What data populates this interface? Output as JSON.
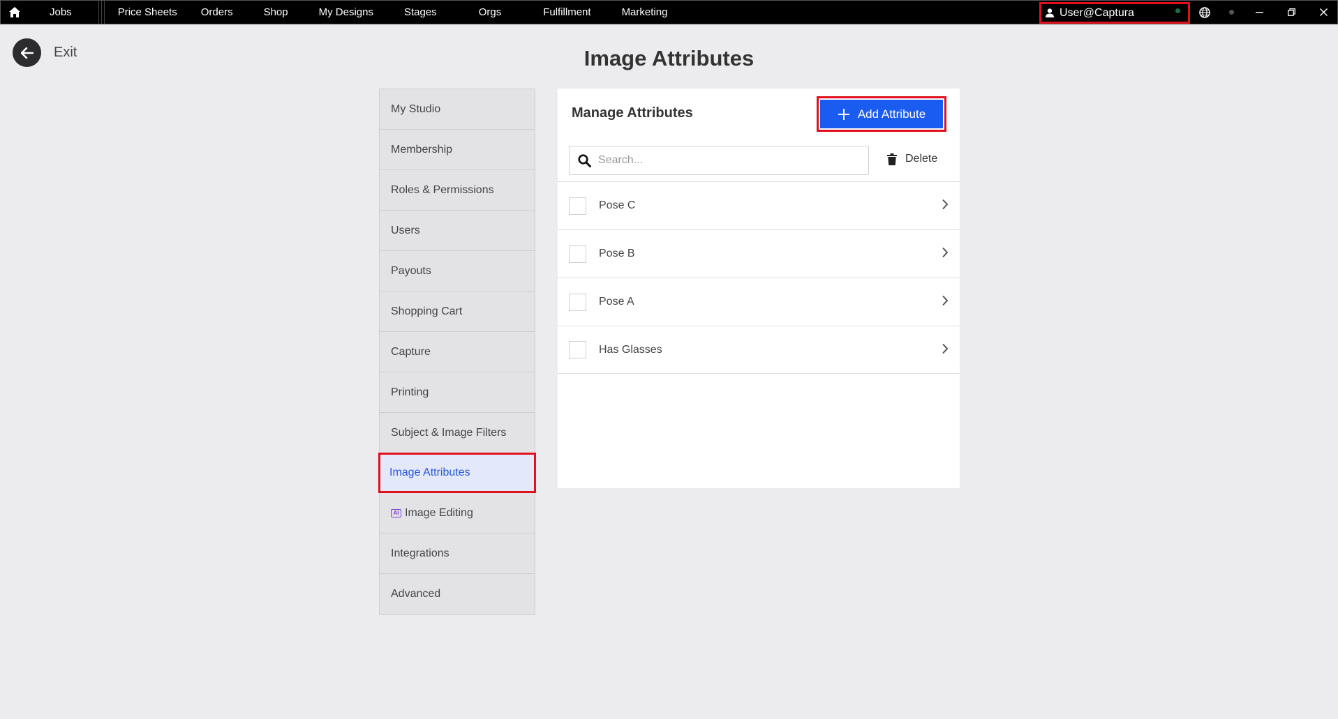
{
  "topbar": {
    "nav": [
      "Jobs",
      "Price Sheets",
      "Orders",
      "Shop",
      "My Designs",
      "Stages",
      "Orgs",
      "Fulfillment",
      "Marketing"
    ],
    "user": "User@Captura",
    "icons": [
      "home-icon",
      "user-icon",
      "globe-icon",
      "status-dot-icon",
      "minimize-icon",
      "restore-icon",
      "close-icon"
    ]
  },
  "exit": {
    "label": "Exit"
  },
  "page": {
    "title": "Image Attributes"
  },
  "sidebar": {
    "items": [
      {
        "label": "My Studio"
      },
      {
        "label": "Membership"
      },
      {
        "label": "Roles & Permissions"
      },
      {
        "label": "Users"
      },
      {
        "label": "Payouts"
      },
      {
        "label": "Shopping Cart"
      },
      {
        "label": "Capture"
      },
      {
        "label": "Printing"
      },
      {
        "label": "Subject & Image Filters"
      },
      {
        "label": "Image Attributes",
        "active": true
      },
      {
        "label": "Image Editing",
        "badge": "AI"
      },
      {
        "label": "Integrations"
      },
      {
        "label": "Advanced"
      }
    ]
  },
  "panel": {
    "title": "Manage Attributes",
    "add_label": "Add Attribute",
    "search_placeholder": "Search...",
    "delete_label": "Delete",
    "rows": [
      {
        "label": "Pose C"
      },
      {
        "label": "Pose B"
      },
      {
        "label": "Pose A"
      },
      {
        "label": "Has Glasses"
      }
    ]
  },
  "colors": {
    "accent": "#1a5bf0",
    "highlight": "#e0101c",
    "active_text": "#2a57d6"
  }
}
